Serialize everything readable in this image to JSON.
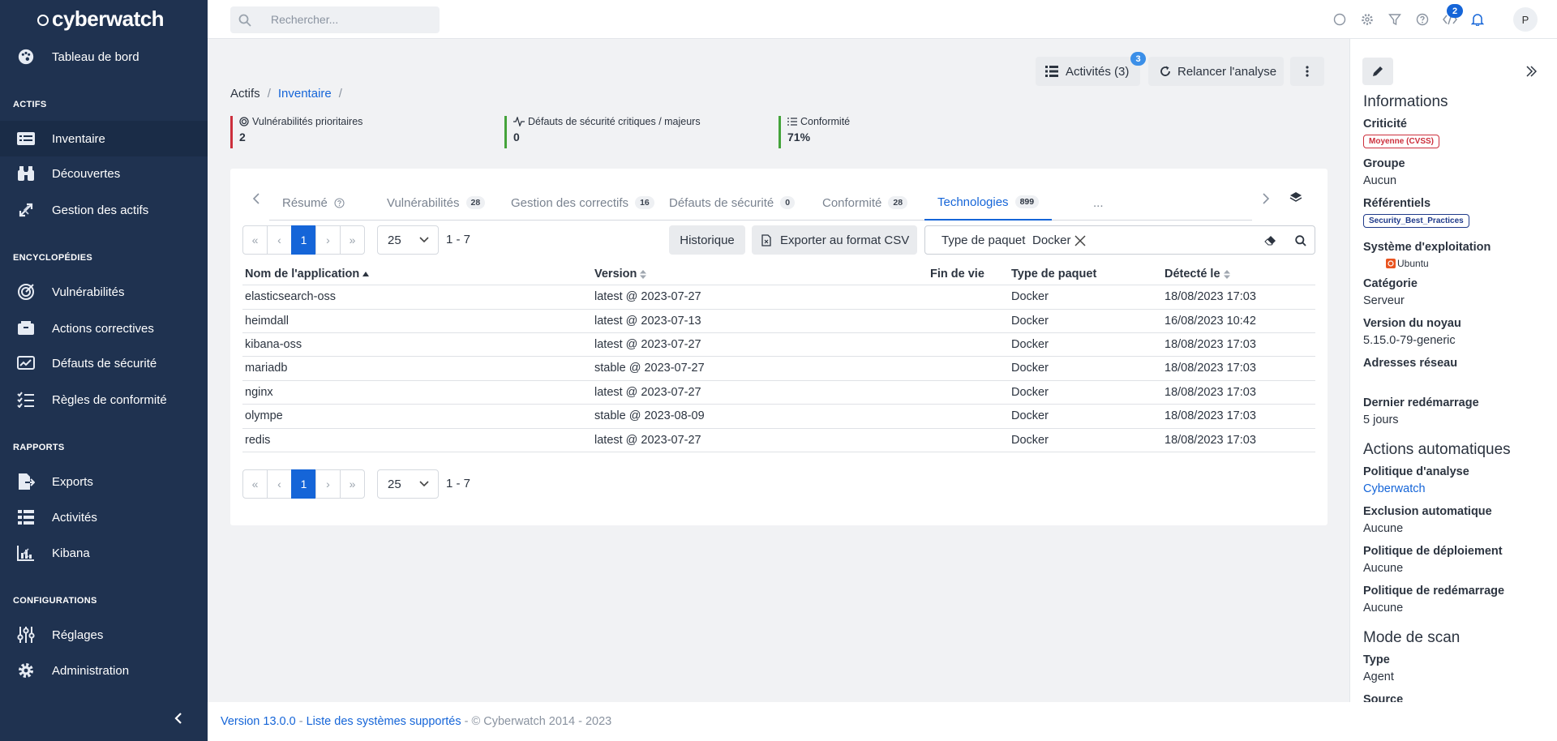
{
  "brand": {
    "name": "cyberwatch"
  },
  "sidebar": {
    "items": [
      {
        "label": "Tableau de bord"
      },
      {
        "label": "Inventaire"
      },
      {
        "label": "Découvertes"
      },
      {
        "label": "Gestion des actifs"
      },
      {
        "label": "Vulnérabilités"
      },
      {
        "label": "Actions correctives"
      },
      {
        "label": "Défauts de sécurité"
      },
      {
        "label": "Règles de conformité"
      },
      {
        "label": "Exports"
      },
      {
        "label": "Activités"
      },
      {
        "label": "Kibana"
      },
      {
        "label": "Réglages"
      },
      {
        "label": "Administration"
      }
    ],
    "sections": [
      "ACTIFS",
      "ENCYCLOPÉDIES",
      "RAPPORTS",
      "CONFIGURATIONS"
    ]
  },
  "topbar": {
    "search_placeholder": "Rechercher...",
    "notification_count": "2",
    "avatar_initial": "P"
  },
  "actions": {
    "activities_label": "Activités (3)",
    "activities_badge": "3",
    "rerun_label": "Relancer l'analyse"
  },
  "breadcrumb": {
    "root": "Actifs",
    "current": "Inventaire",
    "sep": "/"
  },
  "kpis": [
    {
      "title": "Vulnérabilités prioritaires",
      "value": "2",
      "color": "#cc2f3c"
    },
    {
      "title": "Défauts de sécurité critiques / majeurs",
      "value": "0",
      "color": "#44a33a"
    },
    {
      "title": "Conformité",
      "value": "71%",
      "color": "#44a33a"
    }
  ],
  "tabs": [
    {
      "label": "Résumé",
      "count": ""
    },
    {
      "label": "Vulnérabilités",
      "count": "28"
    },
    {
      "label": "Gestion des correctifs",
      "count": "16"
    },
    {
      "label": "Défauts de sécurité",
      "count": "0"
    },
    {
      "label": "Conformité",
      "count": "28"
    },
    {
      "label": "Technologies",
      "count": "899"
    },
    {
      "label": "...",
      "count": ""
    }
  ],
  "pager": {
    "first": "«",
    "prev": "‹",
    "page": "1",
    "next": "›",
    "last": "»",
    "size": "25",
    "range": "1 - 7"
  },
  "toolbar": {
    "history_label": "Historique",
    "export_label": "Exporter au format CSV"
  },
  "filter": {
    "key": "Type de paquet",
    "value": "Docker"
  },
  "table": {
    "headers": [
      "Nom de l'application",
      "Version",
      "Fin de vie",
      "Type de paquet",
      "Détecté le"
    ],
    "rows": [
      [
        "elasticsearch-oss",
        "latest @ 2023-07-27",
        "",
        "Docker",
        "18/08/2023 17:03"
      ],
      [
        "heimdall",
        "latest @ 2023-07-13",
        "",
        "Docker",
        "16/08/2023 10:42"
      ],
      [
        "kibana-oss",
        "latest @ 2023-07-27",
        "",
        "Docker",
        "18/08/2023 17:03"
      ],
      [
        "mariadb",
        "stable @ 2023-07-27",
        "",
        "Docker",
        "18/08/2023 17:03"
      ],
      [
        "nginx",
        "latest @ 2023-07-27",
        "",
        "Docker",
        "18/08/2023 17:03"
      ],
      [
        "olympe",
        "stable @ 2023-08-09",
        "",
        "Docker",
        "18/08/2023 17:03"
      ],
      [
        "redis",
        "latest @ 2023-07-27",
        "",
        "Docker",
        "18/08/2023 17:03"
      ]
    ]
  },
  "panel": {
    "title": "Informations",
    "criticity_label": "Criticité",
    "criticity_value": "Moyenne (CVSS)",
    "group_label": "Groupe",
    "group_value": "Aucun",
    "ref_label": "Référentiels",
    "ref_value": "Security_Best_Practices",
    "os_label": "Système d'exploitation",
    "os_value": "Ubuntu",
    "category_label": "Catégorie",
    "category_value": "Serveur",
    "kernel_label": "Version du noyau",
    "kernel_value": "5.15.0-79-generic",
    "network_label": "Adresses réseau",
    "reboot_label": "Dernier redémarrage",
    "reboot_value": "5 jours",
    "auto_title": "Actions automatiques",
    "analysis_policy_label": "Politique d'analyse",
    "analysis_policy_value": "Cyberwatch",
    "exclusion_label": "Exclusion automatique",
    "exclusion_value": "Aucune",
    "deploy_label": "Politique de déploiement",
    "deploy_value": "Aucune",
    "restart_label": "Politique de redémarrage",
    "restart_value": "Aucune",
    "scan_title": "Mode de scan",
    "type_label": "Type",
    "type_value": "Agent",
    "source_label": "Source"
  },
  "footer": {
    "version": "Version 13.0.0",
    "dash1": " - ",
    "systems": "Liste des systèmes supportés",
    "copyright": " - © Cyberwatch 2014 - 2023"
  }
}
